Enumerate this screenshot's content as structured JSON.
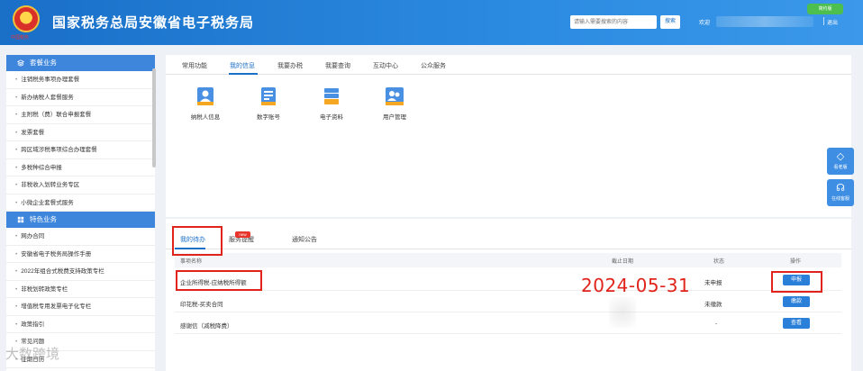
{
  "header": {
    "title": "国家税务总局安徽省电子税务局",
    "emblem_text": "中国税务",
    "search_placeholder": "请输入需要搜索的内容",
    "search_button": "搜索",
    "welcome": "欢迎",
    "logout": "退出",
    "version_badge": "简约版"
  },
  "sidebar": {
    "section1_title": "套餐业务",
    "section1_items": [
      "注销税务事项办理套餐",
      "新办纳税人套餐服务",
      "主附税（费）联合申报套餐",
      "发票套餐",
      "跨区域涉税事项综合办理套餐",
      "多税种综合申报",
      "非税收入划转业务专区",
      "小微企业套餐式服务"
    ],
    "section2_title": "特色业务",
    "section2_items": [
      "网办合同",
      "安徽省电子税务局操作手册",
      "2022年组合式税费支持政策专栏",
      "非税划转政策专栏",
      "增值税专用发票电子化专栏",
      "政策指引",
      "常见问题",
      "征期日历"
    ]
  },
  "top_tabs": [
    "常用功能",
    "我的信息",
    "我要办税",
    "我要查询",
    "互动中心",
    "公众服务"
  ],
  "quick_icons": [
    {
      "label": "纳税人信息",
      "icon": "user-card-icon"
    },
    {
      "label": "数字账号",
      "icon": "document-icon"
    },
    {
      "label": "电子资料",
      "icon": "stack-icon"
    },
    {
      "label": "用户管理",
      "icon": "users-icon"
    }
  ],
  "float_buttons": [
    "看老版",
    "在线客服"
  ],
  "bottom_tabs": [
    "我的待办",
    "服务提醒",
    "通知公告"
  ],
  "new_badge": "new",
  "table": {
    "headers": [
      "事项名称",
      "截止日期",
      "状态",
      "操作"
    ],
    "rows": [
      {
        "name": "企业所得税-应纳税所得额",
        "deadline": "",
        "status": "未申报",
        "action": "申报"
      },
      {
        "name": "印花税-买卖合同",
        "deadline": "",
        "status": "未缴款",
        "action": "缴款"
      },
      {
        "name": "感谢信（减税降费）",
        "deadline": "",
        "status": "-",
        "action": "查看"
      }
    ]
  },
  "annotation_date": "2024-05-31",
  "watermark": "大数跨境",
  "colors": {
    "brand": "#1a6fc7",
    "accent": "#3e86dc",
    "annotation": "#e0241b"
  }
}
